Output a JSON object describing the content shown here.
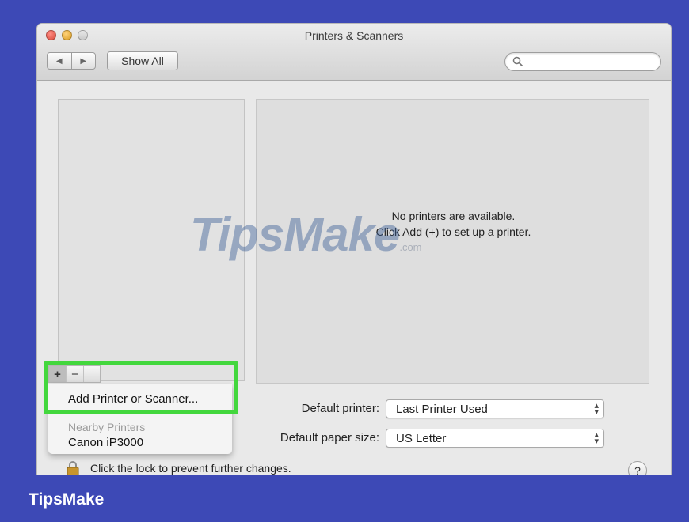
{
  "window": {
    "title": "Printers & Scanners"
  },
  "toolbar": {
    "back_label": "◀",
    "forward_label": "▶",
    "show_all_label": "Show All",
    "search_placeholder": ""
  },
  "main": {
    "empty_line1": "No printers are available.",
    "empty_line2": "Click Add (+) to set up a printer."
  },
  "list_controls": {
    "add_label": "+",
    "remove_label": "−"
  },
  "add_menu": {
    "add_item": "Add Printer or Scanner...",
    "nearby_header": "Nearby Printers",
    "nearby_items": [
      "Canon iP3000"
    ]
  },
  "settings": {
    "default_printer_label": "Default printer:",
    "default_printer_value": "Last Printer Used",
    "default_paper_label": "Default paper size:",
    "default_paper_value": "US Letter"
  },
  "lock": {
    "text": "Click the lock to prevent further changes."
  },
  "help_label": "?",
  "watermark": {
    "text": "TipsMake",
    "suffix": ".com"
  },
  "footer": {
    "brand": "TipsMake"
  },
  "colors": {
    "banner": "#3d49b6",
    "highlight": "#43d73d"
  }
}
